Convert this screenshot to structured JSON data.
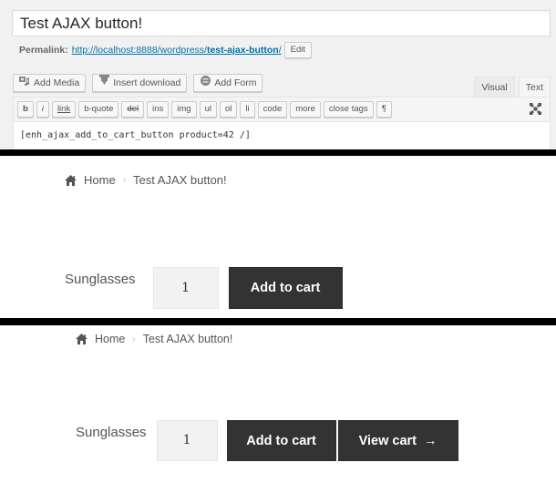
{
  "editor": {
    "post_title": "Test AJAX button!",
    "permalink": {
      "label": "Permalink:",
      "url_base": "http://localhost:8888/wordpress/",
      "slug": "test-ajax-button",
      "trailing": "/",
      "edit_label": "Edit"
    },
    "media_buttons": [
      {
        "label": "Add Media",
        "icon": "media-icon"
      },
      {
        "label": "Insert download",
        "icon": "download-icon"
      },
      {
        "label": "Add Form",
        "icon": "form-icon"
      }
    ],
    "tabs": [
      {
        "label": "Visual",
        "active": false
      },
      {
        "label": "Text",
        "active": true
      }
    ],
    "quicktags": [
      "b",
      "i",
      "link",
      "b-quote",
      "del",
      "ins",
      "img",
      "ul",
      "ol",
      "li",
      "code",
      "more",
      "close tags",
      "¶"
    ],
    "content": "[enh_ajax_add_to_cart_button product=42 /]"
  },
  "before": {
    "breadcrumb": {
      "home": "Home",
      "current": "Test AJAX button!"
    },
    "product_name": "Sunglasses",
    "quantity": "1",
    "add_to_cart_label": "Add to cart"
  },
  "after": {
    "breadcrumb": {
      "home": "Home",
      "current": "Test AJAX button!"
    },
    "product_name": "Sunglasses",
    "quantity": "1",
    "add_to_cart_label": "Add to cart",
    "view_cart_label": "View cart",
    "view_cart_arrow": "→"
  }
}
